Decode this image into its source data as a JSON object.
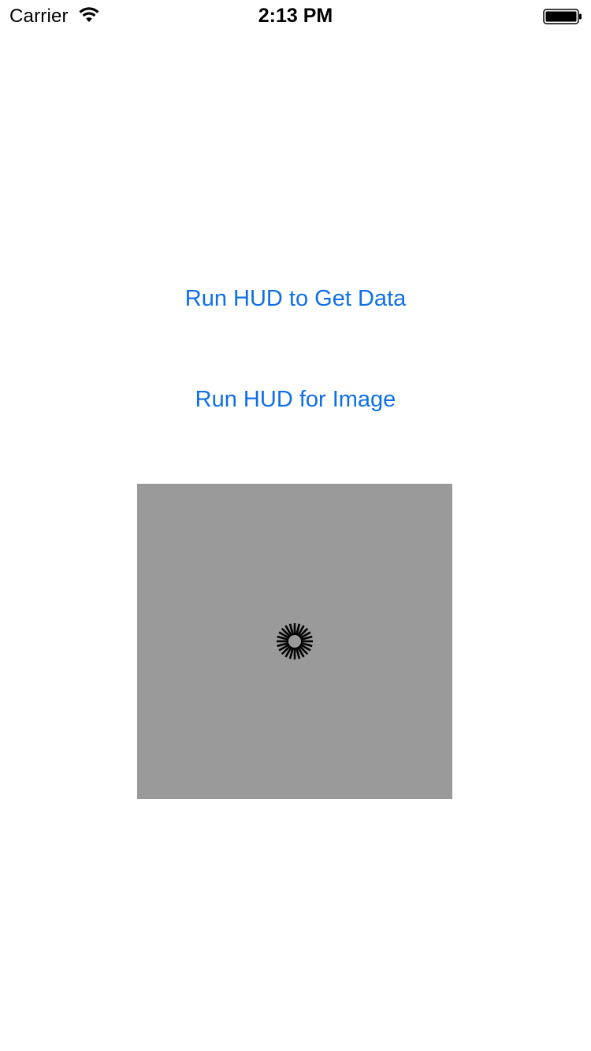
{
  "status_bar": {
    "carrier": "Carrier",
    "time": "2:13 PM",
    "wifi_icon": "wifi-icon",
    "battery_icon": "battery-icon"
  },
  "buttons": {
    "get_data_label": "Run HUD to Get Data",
    "image_label": "Run HUD for Image"
  },
  "image_view": {
    "background_color": "#9a9a9a",
    "spinner_icon": "activity-spinner-icon"
  },
  "colors": {
    "accent": "#0f6fe6"
  }
}
